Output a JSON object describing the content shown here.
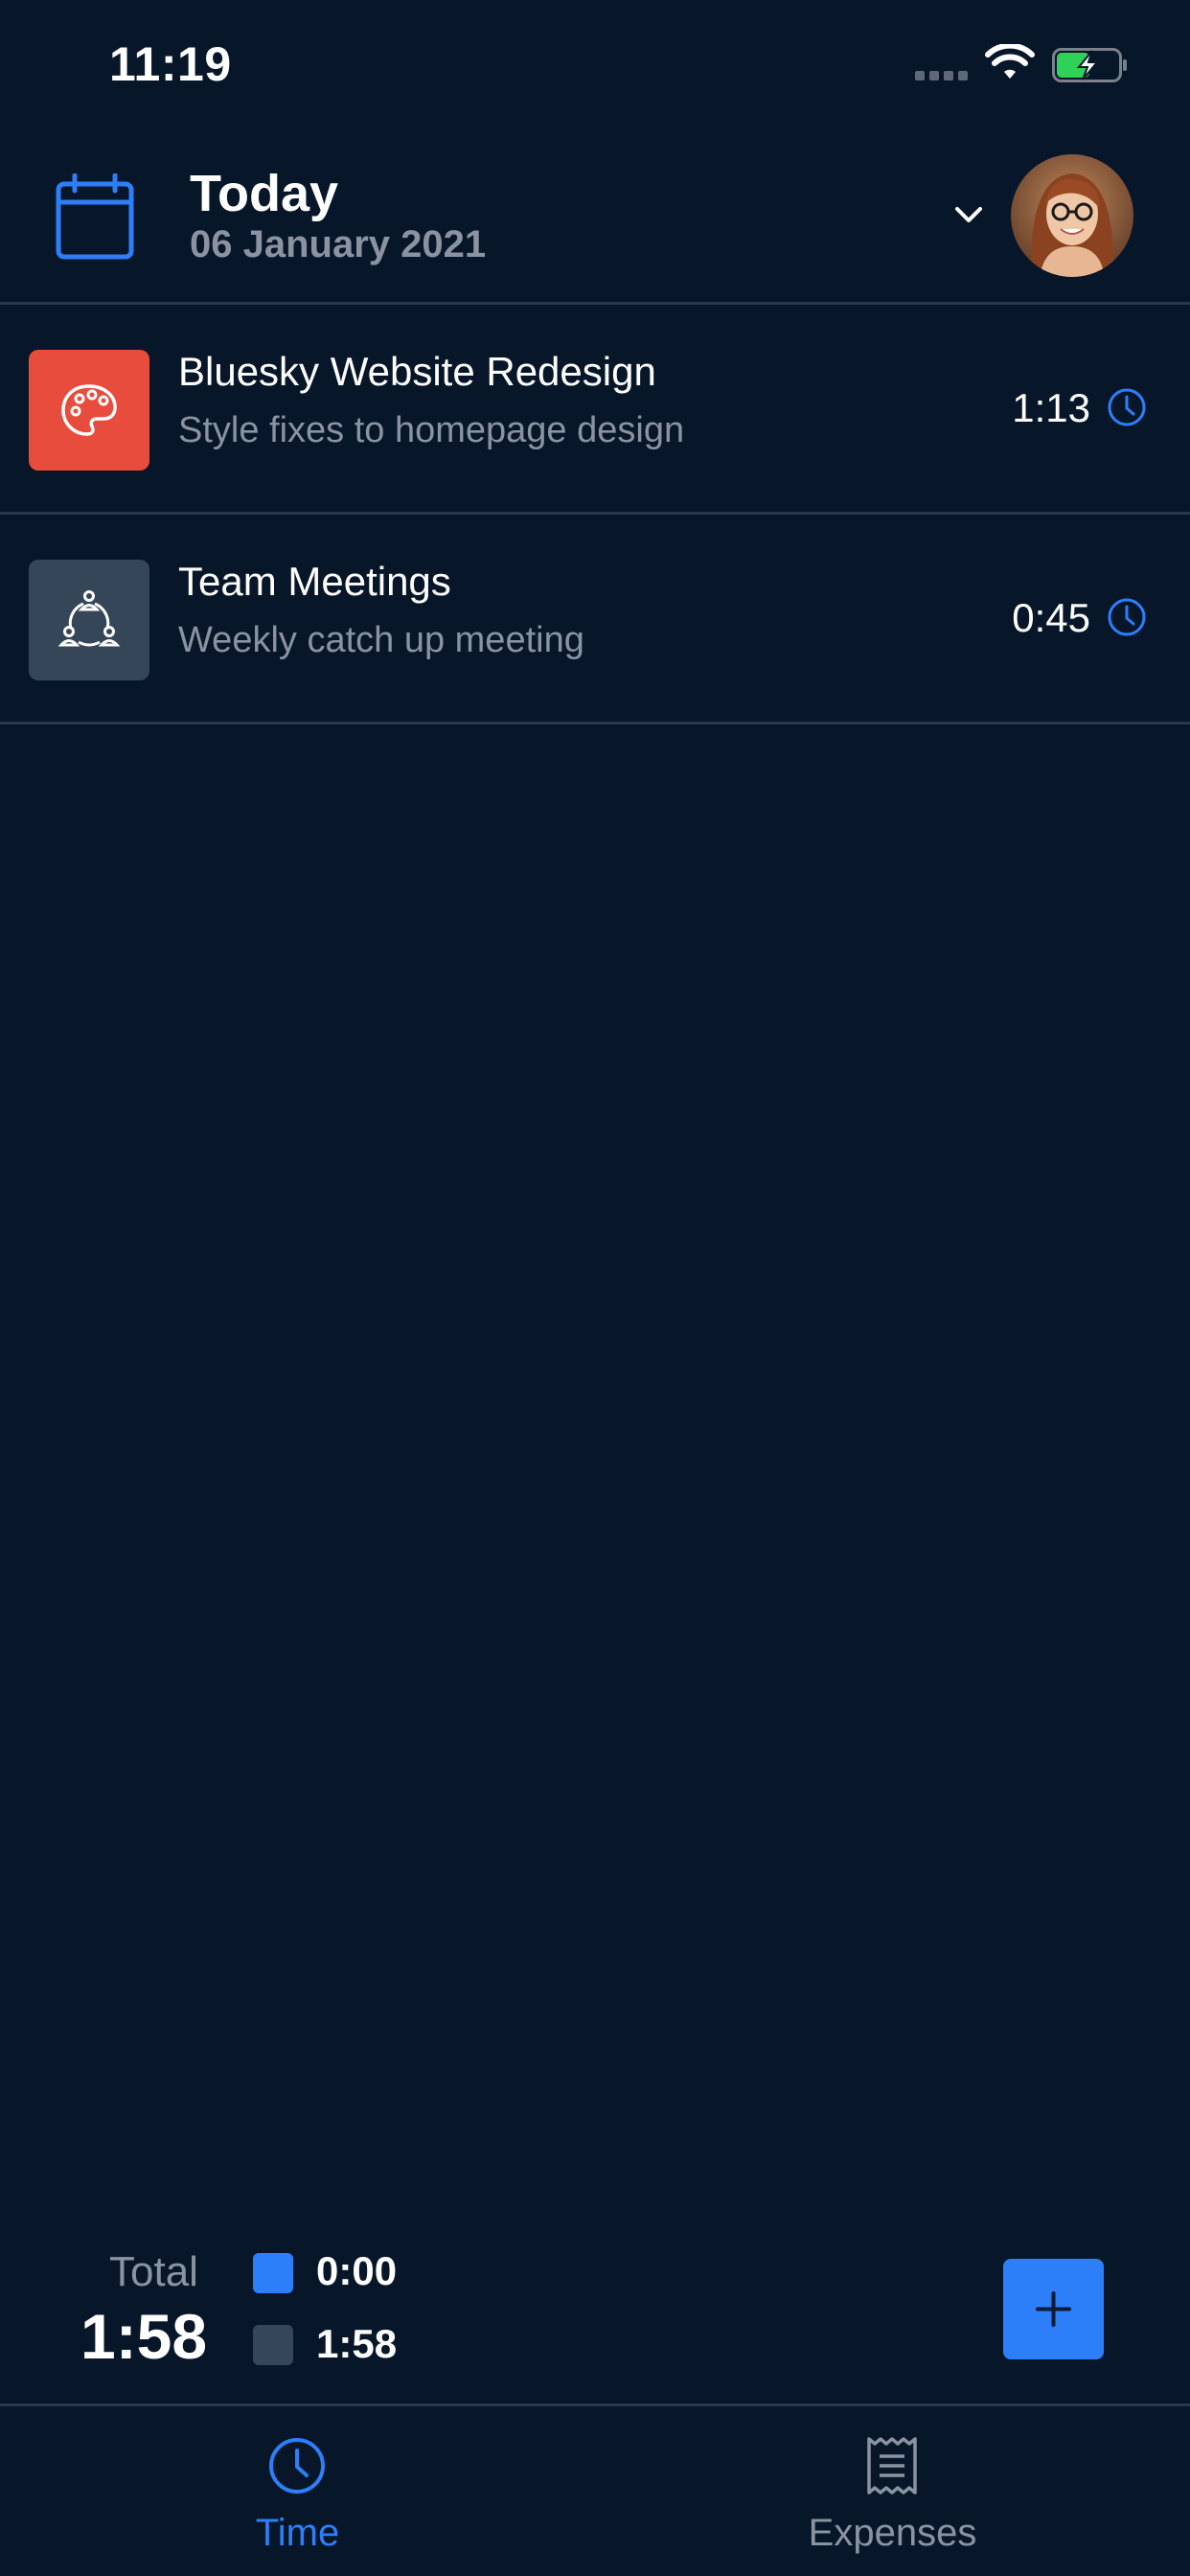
{
  "status_bar": {
    "time": "11:19"
  },
  "header": {
    "title": "Today",
    "date": "06 January 2021"
  },
  "entries": [
    {
      "title": "Bluesky Website Redesign",
      "subtitle": "Style fixes to homepage design",
      "duration": "1:13",
      "icon": "palette-icon",
      "color": "#e84c3d"
    },
    {
      "title": "Team Meetings",
      "subtitle": "Weekly catch up meeting",
      "duration": "0:45",
      "icon": "team-icon",
      "color": "#364659"
    }
  ],
  "totals": {
    "label": "Total",
    "value": "1:58",
    "legend": [
      {
        "value": "0:00",
        "color": "#2d7ff9"
      },
      {
        "value": "1:58",
        "color": "#364659"
      }
    ]
  },
  "add_button": {
    "icon": "plus-icon"
  },
  "tabs": [
    {
      "label": "Time",
      "icon": "clock-icon",
      "active": true
    },
    {
      "label": "Expenses",
      "icon": "receipt-icon",
      "active": false
    }
  ],
  "colors": {
    "background": "#08162a",
    "accent": "#2d7ff9",
    "muted_text": "#8a93a2",
    "divider": "#2a3748"
  }
}
